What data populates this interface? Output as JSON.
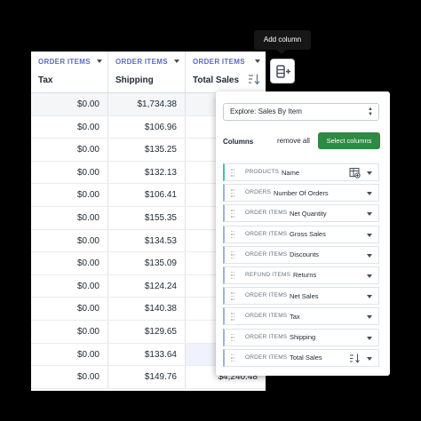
{
  "table": {
    "columns": [
      {
        "group": "ORDER ITEMS",
        "field": "Tax"
      },
      {
        "group": "ORDER ITEMS",
        "field": "Shipping"
      },
      {
        "group": "ORDER ITEMS",
        "field": "Total Sales"
      }
    ],
    "rows": [
      [
        "$0.00",
        "$1,734.38",
        ""
      ],
      [
        "$0.00",
        "$106.96",
        ""
      ],
      [
        "$0.00",
        "$135.25",
        ""
      ],
      [
        "$0.00",
        "$132.13",
        ""
      ],
      [
        "$0.00",
        "$106.41",
        ""
      ],
      [
        "$0.00",
        "$155.35",
        ""
      ],
      [
        "$0.00",
        "$134.53",
        ""
      ],
      [
        "$0.00",
        "$135.09",
        ""
      ],
      [
        "$0.00",
        "$124.24",
        ""
      ],
      [
        "$0.00",
        "$140.38",
        ""
      ],
      [
        "$0.00",
        "$129.65",
        ""
      ],
      [
        "$0.00",
        "$133.64",
        ""
      ],
      [
        "$0.00",
        "$149.76",
        "$4,240.48"
      ]
    ]
  },
  "tooltip": {
    "text": "Add column"
  },
  "panel": {
    "explore_label": "Explore: Sales By Item",
    "columns_title": "Columns",
    "remove_all": "remove all",
    "select_columns": "Select columns",
    "items": [
      {
        "group": "PRODUCTS",
        "field": "Name",
        "icon": "columns-icon"
      },
      {
        "group": "ORDERS",
        "field": "Number Of Orders"
      },
      {
        "group": "ORDER ITEMS",
        "field": "Net Quantity"
      },
      {
        "group": "ORDER ITEMS",
        "field": "Gross Sales"
      },
      {
        "group": "ORDER ITEMS",
        "field": "Discounts"
      },
      {
        "group": "REFUND ITEMS",
        "field": "Returns"
      },
      {
        "group": "ORDER ITEMS",
        "field": "Net Sales"
      },
      {
        "group": "ORDER ITEMS",
        "field": "Tax"
      },
      {
        "group": "ORDER ITEMS",
        "field": "Shipping"
      },
      {
        "group": "ORDER ITEMS",
        "field": "Total Sales",
        "icon": "sort-icon"
      }
    ]
  }
}
